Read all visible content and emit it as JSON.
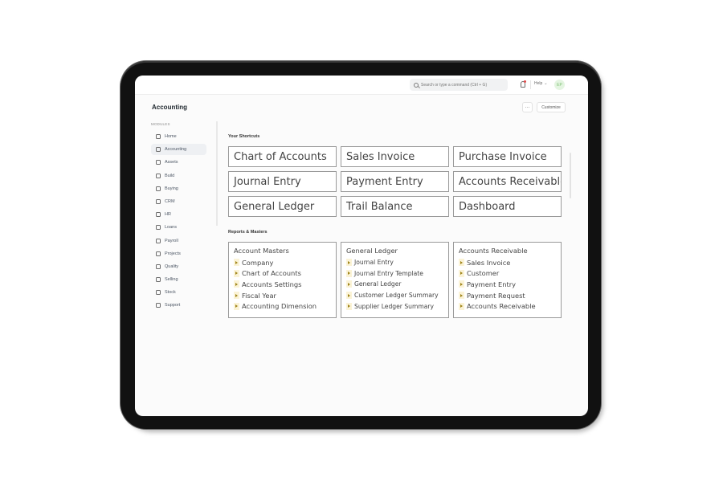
{
  "navbar": {
    "search_placeholder": "Search or type a command (Ctrl + G)",
    "help_label": "Help",
    "avatar_initials": "EP"
  },
  "page": {
    "title": "Accounting",
    "more_label": "···",
    "customize_label": "Customize"
  },
  "sidebar": {
    "heading": "MODULES",
    "active": "Accounting",
    "items": [
      {
        "label": "Home",
        "icon": "home-icon"
      },
      {
        "label": "Accounting",
        "icon": "accounting-icon"
      },
      {
        "label": "Assets",
        "icon": "assets-icon"
      },
      {
        "label": "Build",
        "icon": "build-icon"
      },
      {
        "label": "Buying",
        "icon": "buying-icon"
      },
      {
        "label": "CRM",
        "icon": "crm-icon"
      },
      {
        "label": "HR",
        "icon": "hr-icon"
      },
      {
        "label": "Loans",
        "icon": "loans-icon"
      },
      {
        "label": "Payroll",
        "icon": "payroll-icon"
      },
      {
        "label": "Projects",
        "icon": "projects-icon"
      },
      {
        "label": "Quality",
        "icon": "quality-icon"
      },
      {
        "label": "Selling",
        "icon": "selling-icon"
      },
      {
        "label": "Stock",
        "icon": "stock-icon"
      },
      {
        "label": "Support",
        "icon": "support-icon"
      }
    ]
  },
  "shortcuts": {
    "heading": "Your Shortcuts",
    "items": [
      "Chart of Accounts",
      "Sales Invoice",
      "Purchase Invoice",
      "Journal Entry",
      "Payment Entry",
      "Accounts Receivable",
      "General Ledger",
      "Trail Balance",
      "Dashboard"
    ]
  },
  "reports": {
    "heading": "Reports & Masters",
    "cards": [
      {
        "title": "Account Masters",
        "links": [
          "Company",
          "Chart of Accounts",
          "Accounts Settings",
          "Fiscal Year",
          "Accounting Dimension"
        ]
      },
      {
        "title": "General Ledger",
        "links": [
          "Journal Entry",
          "Journal Entry Template",
          "General Ledger",
          "Customer Ledger Summary",
          "Supplier Ledger Summary"
        ]
      },
      {
        "title": "Accounts Receivable",
        "links": [
          "Sales Invoice",
          "Customer",
          "Payment Entry",
          "Payment Request",
          "Accounts Receivable"
        ]
      }
    ]
  }
}
